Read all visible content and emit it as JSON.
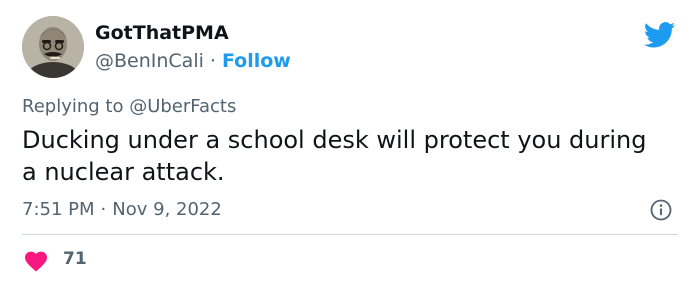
{
  "user": {
    "display_name": "GotThatPMA",
    "handle": "@BenInCali",
    "separator": "·",
    "follow_label": "Follow"
  },
  "reply": {
    "prefix": "Replying to ",
    "mention": "@UberFacts"
  },
  "tweet": {
    "text": "Ducking under a school desk will protect you during a nuclear attack.",
    "time": "7:51 PM",
    "separator": "·",
    "date": "Nov 9, 2022"
  },
  "engagement": {
    "likes": "71"
  },
  "icons": {
    "logo": "twitter-bird-icon",
    "info": "info-icon",
    "like": "heart-icon"
  },
  "colors": {
    "accent": "#1d9bf0",
    "text": "#0f1419",
    "muted": "#536471",
    "like": "#f91880",
    "divider": "#cfd9de"
  }
}
